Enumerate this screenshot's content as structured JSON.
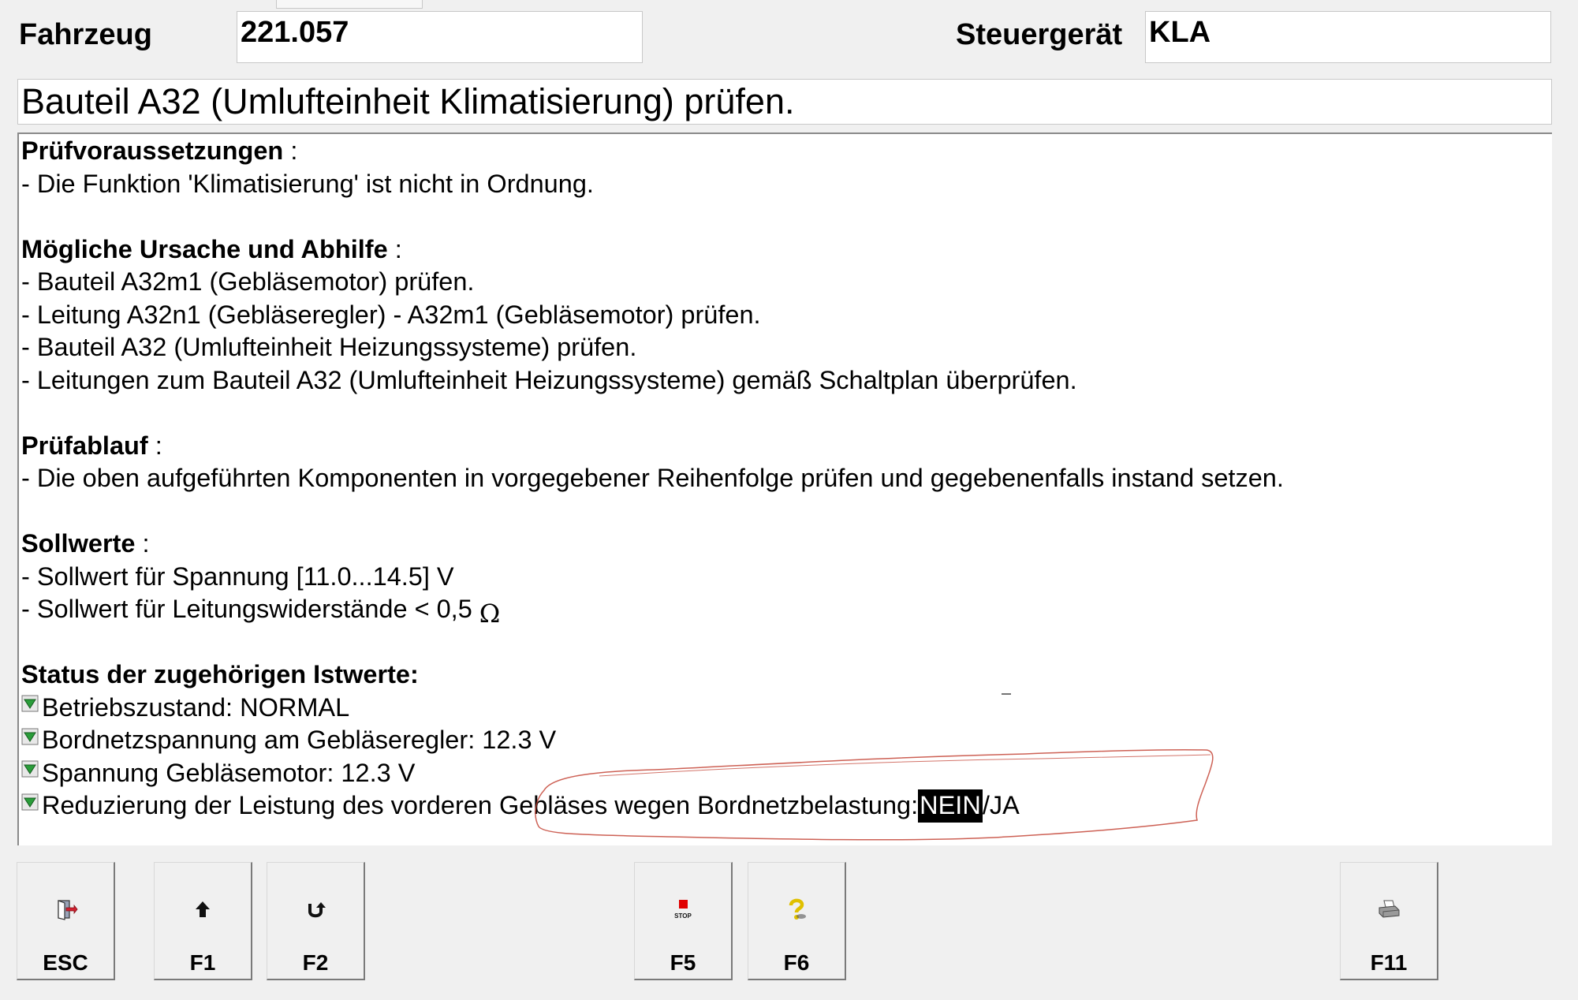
{
  "header": {
    "vehicle_label": "Fahrzeug",
    "vehicle_value": "221.057",
    "ecu_label": "Steuergerät",
    "ecu_value": "KLA"
  },
  "title": "Bauteil A32 (Umlufteinheit Klimatisierung) prüfen.",
  "content": {
    "prerequisites": {
      "heading": "Prüfvoraussetzungen",
      "suffix": " :",
      "lines": [
        "- Die Funktion 'Klimatisierung' ist nicht in Ordnung."
      ]
    },
    "causes": {
      "heading": "Mögliche Ursache und Abhilfe",
      "suffix": " :",
      "lines": [
        "- Bauteil A32m1 (Gebläsemotor) prüfen.",
        "- Leitung A32n1 (Gebläseregler) - A32m1 (Gebläsemotor) prüfen.",
        "- Bauteil A32 (Umlufteinheit Heizungssysteme) prüfen.",
        "- Leitungen zum Bauteil A32 (Umlufteinheit Heizungssysteme) gemäß Schaltplan überprüfen."
      ]
    },
    "procedure": {
      "heading": "Prüfablauf",
      "suffix": " :",
      "lines": [
        "- Die oben aufgeführten Komponenten in vorgegebener Reihenfolge prüfen und gegebenenfalls instand setzen."
      ]
    },
    "nominal": {
      "heading": "Sollwerte",
      "suffix": " :",
      "line1": "- Sollwert für Spannung [11.0...14.5] V",
      "line2": "- Sollwert für Leitungswiderstände < 0,5 ",
      "ohm": "Ω"
    },
    "status": {
      "heading": "Status der zugehörigen Istwerte:",
      "rows": [
        "Betriebszustand: NORMAL",
        "Bordnetzspannung am Gebläseregler: 12.3 V",
        "Spannung Gebläsemotor: 12.3 V"
      ],
      "last_row_prefix": "Reduzierung der Leistung des vorderen Gebläses wegen Bordnetzbelastung: ",
      "last_row_selected": "NEIN",
      "last_row_rest": "/JA"
    }
  },
  "buttons": [
    {
      "key": "ESC",
      "icon": "exit-door-icon"
    },
    {
      "key": "F1",
      "icon": "arrow-up-icon"
    },
    {
      "key": "F2",
      "icon": "u-turn-icon"
    },
    {
      "key": "F5",
      "icon": "stop-icon",
      "icon_text": "STOP"
    },
    {
      "key": "F6",
      "icon": "help-question-icon"
    },
    {
      "key": "F11",
      "icon": "printer-icon"
    }
  ],
  "colors": {
    "annotation": "#c0392b",
    "selected_bg": "#000000",
    "icon_green": "#2a9d3a"
  }
}
